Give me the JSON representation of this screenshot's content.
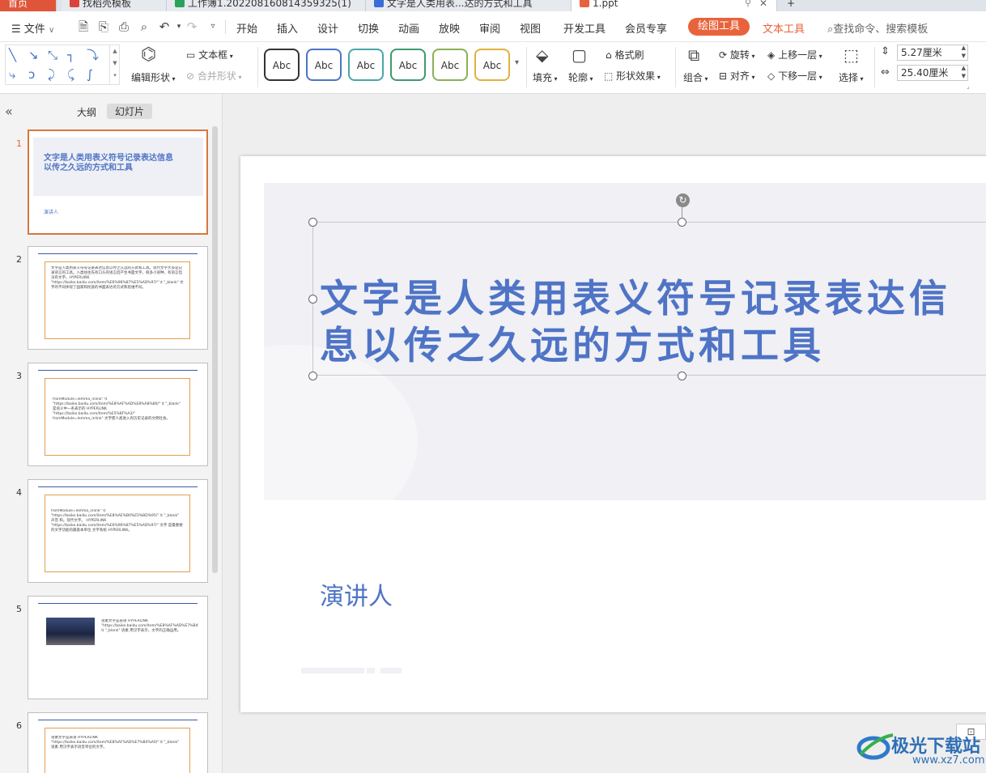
{
  "tabs": {
    "home": "首页",
    "t1": "找稻壳模板",
    "t2": "工作簿1.202208160814359325(1)",
    "t3": "文字是人类用表...达的方式和工具",
    "t4": "1.ppt",
    "add": "+"
  },
  "menu": {
    "file": "文件",
    "items": [
      "开始",
      "插入",
      "设计",
      "切换",
      "动画",
      "放映",
      "审阅",
      "视图",
      "开发工具",
      "会员专享"
    ],
    "drawing_tools": "绘图工具",
    "text_tools": "文本工具",
    "search": "查找命令、搜索模板"
  },
  "ribbon": {
    "edit_shape": "编辑形状",
    "text_box": "文本框",
    "merge_shape": "合并形状",
    "style_label": "Abc",
    "fill": "填充",
    "outline": "轮廓",
    "format_painter": "格式刷",
    "shape_effect": "形状效果",
    "group": "组合",
    "rotate": "旋转",
    "align": "对齐",
    "bring_forward": "上移一层",
    "send_backward": "下移一层",
    "select": "选择",
    "height": "5.27厘米",
    "width": "25.40厘米"
  },
  "panel": {
    "outline_tab": "大纲",
    "slides_tab": "幻灯片",
    "collapse": "«"
  },
  "thumbnails": [
    {
      "num": "1",
      "title": "文字是人类用表义符号记录表达信息以传之久远的方式和工具",
      "sub": "演讲人"
    },
    {
      "num": "2",
      "text": "文字是人类用表义符号记录表达信息以传之久远的方式和工具。现代文字大多是记录语言的工具。人类往往先有口头的语言后产生书面文字，很多小语种，有语言但没有文字。HYPERLINK \"https://baike.baidu.com/item/%E6%96%87%E5%AD%97/\" \\t \"_blank\" 文字的不同体现了国家和民族的书面表达的方式和思维不同。"
    },
    {
      "num": "3",
      "text": "fromModule=lemma_inlink\" \\t \"https://baike.baidu.com/item/%E8%AF%AD%E8%A8%80/\" \\t \"_blank\" 是语义中一条表示的 HYPERLINK \"https://baike.baidu.com/item/%E5%8F%A3/\" fromModule=lemma_inlink\" 文字使人类进入有历史记录的文明社会。"
    },
    {
      "num": "4",
      "text": "fromModule=lemma_inlink\" \\t \"https://baike.baidu.com/item/%E8%AE%B0%E5%BD%95/\" \\t \"_blank\" 声音 和。现代文字。 HYPERLINK \"https://baike.baidu.com/item/%E6%96%87%E5%AD%97/\" 文字 是最重要的文字功能的最基本单位 文字系统 HYPERLINK。"
    },
    {
      "num": "5",
      "text": "语素文字是表语 HYPERLINK \"https://baike.baidu.com/item/%E8%AF%AD%E7%B4%A0/\" \\t \"_blank\" 语素 用汉字表示，文字的正确运用。"
    },
    {
      "num": "6",
      "text": "语素文字是表语 HYPERLINK \"https://baike.baidu.com/item/%E8%AF%AD%E7%B4%A0/\" \\t \"_blank\" 语素 用汉字表示语音单位的文字。"
    }
  ],
  "slide": {
    "title": "文字是人类用表义符号记录表达信息以传之久远的方式和工具",
    "speaker": "演讲人"
  },
  "watermark": {
    "name": "极光下载站",
    "url": "www.xz7.com"
  },
  "colors": {
    "accent": "#e8633b",
    "title_blue": "#4f74c6",
    "thumb_frame": "#e0a050",
    "thumb_line": "#3b5aa9"
  }
}
